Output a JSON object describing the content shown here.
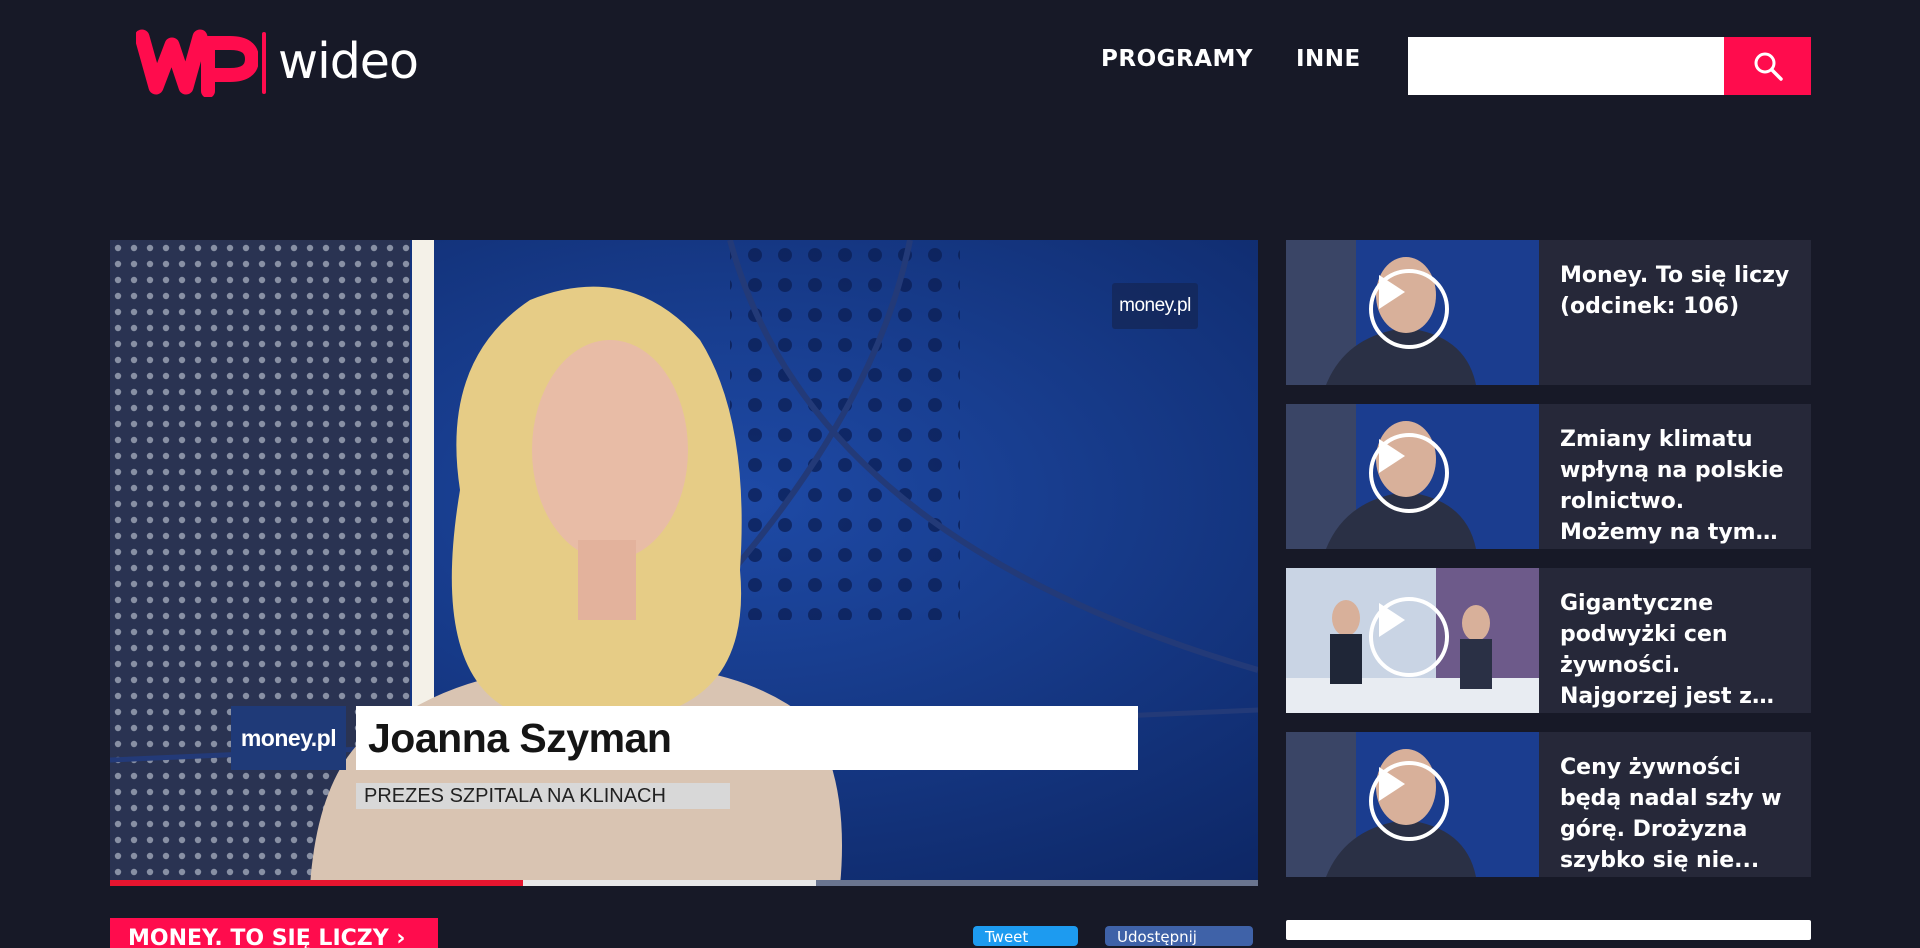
{
  "header": {
    "logo_mark": "WP",
    "logo_text": "wideo",
    "nav": [
      {
        "label": "PROGRAMY"
      },
      {
        "label": "INNE"
      }
    ],
    "search": {
      "placeholder": "",
      "value": "",
      "icon": "search-icon"
    }
  },
  "player": {
    "watermark": "money.pl",
    "lower_third": {
      "logo": "money.pl",
      "name": "Joanna Szyman",
      "role": "PREZES SZPITALA NA KLINACH"
    },
    "progress": {
      "played_fraction": 0.36,
      "buffered_fraction": 0.615
    }
  },
  "related": [
    {
      "title": "Money. To się liczy (odcinek: 106)"
    },
    {
      "title": "Zmiany klimatu wpłyną na polskie rolnictwo. Możemy na tym skorzystać..."
    },
    {
      "title": "Gigantyczne podwyżki cen żywności. Najgorzej jest z warzywami..."
    },
    {
      "title": "Ceny żywności będą nadal szły w górę. Drożyzna szybko się nie..."
    }
  ],
  "bottom": {
    "show_tag": "MONEY. TO SIĘ LICZY ›",
    "share_twitter": "Tweet",
    "share_facebook": "Udostępnij"
  },
  "colors": {
    "background": "#171927",
    "accent": "#ff0c4d",
    "card": "#262839",
    "progress": "#e6152f"
  }
}
